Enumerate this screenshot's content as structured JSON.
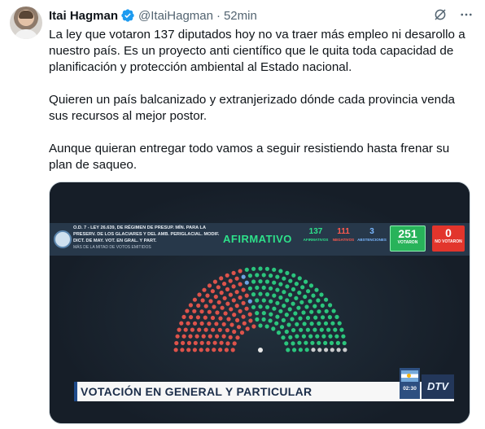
{
  "author": {
    "name": "Itai Hagman",
    "handle": "@ItaiHagman",
    "separator": "·",
    "time": "52min"
  },
  "icons": {
    "verified": "verified-badge-icon",
    "grok": "grok-icon",
    "more": "more-icon"
  },
  "tweet": {
    "paragraph_1": "La ley que votaron 137 diputados hoy no va traer más empleo ni desarollo a nuestro país. Es un proyecto anti científico que le quita toda capacidad de planificación y protección ambiental al Estado nacional.",
    "paragraph_2": "Quieren un país balcanizado y extranjerizado dónde cada provincia venda sus recursos al mejor postor.",
    "paragraph_3": "Aunque quieran entregar todo vamos a seguir resistiendo hasta frenar su plan de saqueo."
  },
  "media": {
    "vote_description": "O.D. 7 - LEY 26.639, DE RÉGIMEN DE PRESUP. MÍN. PARA LA PRESERV. DE LOS GLACIARES Y DEL AMB. PERIGLACIAL. MODIF. DICT. DE MAY. VOT. EN GRAL. Y PART.",
    "vote_sub": "MÁS DE LA MITAD DE VOTOS EMITIDOS",
    "result": "AFIRMATIVO",
    "afirmativos_n": "137",
    "afirmativos_l": "AFIRMATIVOS",
    "negativos_n": "111",
    "negativos_l": "NEGATIVOS",
    "abstenciones_n": "3",
    "abstenciones_l": "ABSTENCIONES",
    "votaron_n": "251",
    "votaron_l": "VOTARON",
    "no_votaron_n": "0",
    "no_votaron_l": "NO VOTARON",
    "lower_third": "VOTACIÓN EN GENERAL Y PARTICULAR",
    "clock": "02:30",
    "channel": "DTV",
    "seat_counts": {
      "afirmativos": 137,
      "negativos": 111,
      "abstenciones": 3,
      "total": 257
    }
  },
  "colors": {
    "afirmativo": "#2ee08a",
    "negativo": "#ff5a4f",
    "abstencion": "#7ab7ff",
    "sin_voto": "#e8e8e8",
    "verified": "#1d9bf0"
  }
}
